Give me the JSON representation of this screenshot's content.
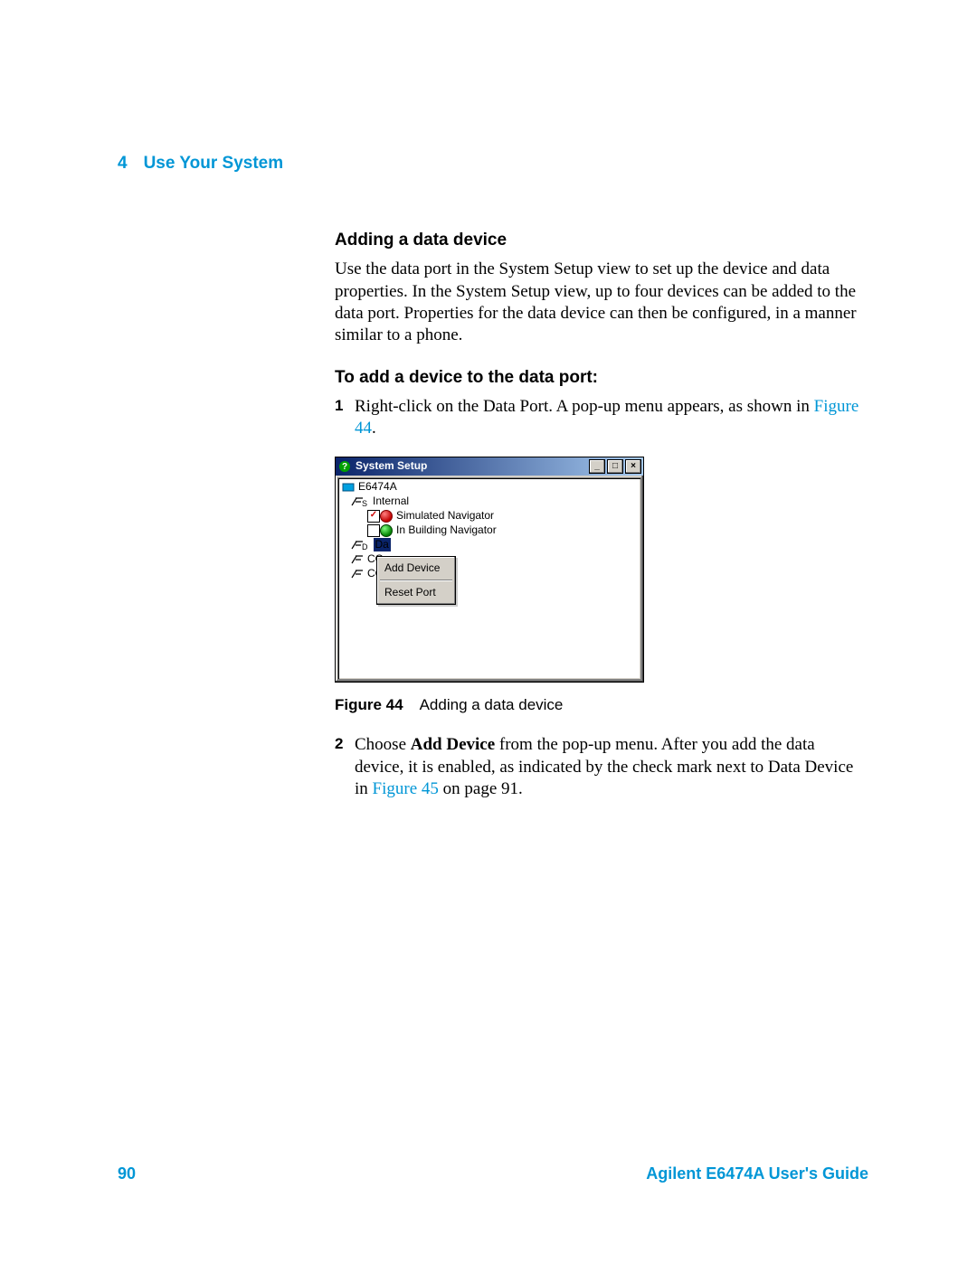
{
  "header": {
    "chapter_num": "4",
    "chapter_title": "Use Your System"
  },
  "section": {
    "title": "Adding a data device",
    "intro": "Use the data port in the System Setup view to set up the device and data properties. In the System Setup view, up to four devices can be added to the data port. Properties for the data device can then be configured, in a manner similar to a phone.",
    "task_title": "To add a device to the data port:",
    "steps": {
      "s1_num": "1",
      "s1a": "Right-click on the Data Port. A pop-up menu appears, as shown in ",
      "s1_link": "Figure 44",
      "s1b": ".",
      "s2_num": "2",
      "s2a": "Choose ",
      "s2_bold": "Add Device",
      "s2b": " from the pop-up menu. After you add the data device, it is enabled, as indicated by the check mark next to Data Device in ",
      "s2_link": "Figure 45",
      "s2c": " on page 91."
    }
  },
  "figure": {
    "label": "Figure 44",
    "caption": "Adding a data device"
  },
  "window": {
    "title": "System Setup",
    "root": "E6474A",
    "internal": "Internal",
    "dev1": "Simulated Navigator",
    "dev2": "In Building Navigator",
    "port_da": "Da",
    "port_co1": "CO",
    "port_co2": "CO",
    "menu_add": "Add Device",
    "menu_reset": "Reset Port"
  },
  "footer": {
    "page": "90",
    "doc": "Agilent E6474A User's Guide"
  }
}
